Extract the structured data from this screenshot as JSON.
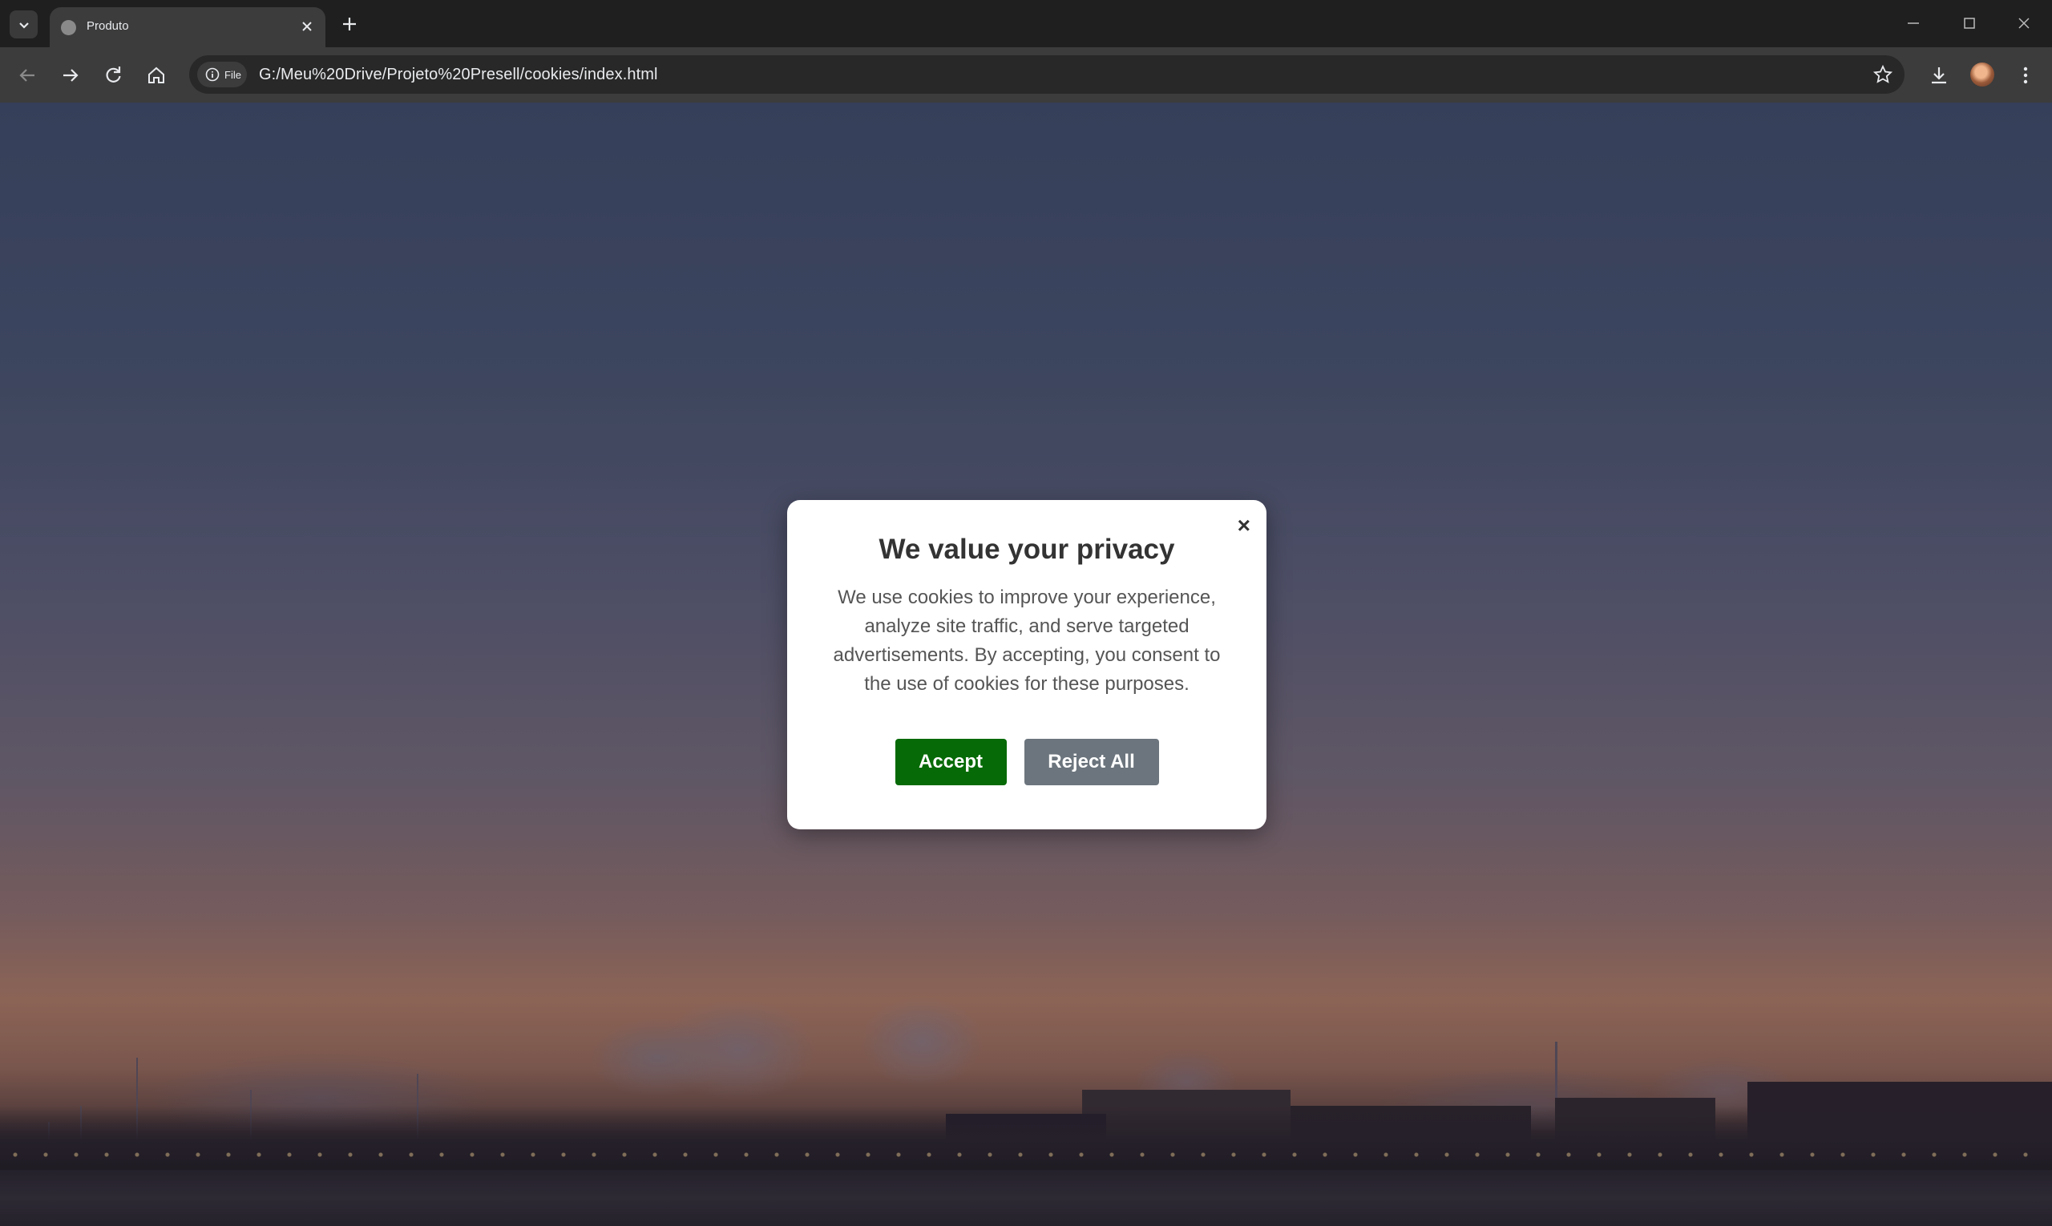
{
  "browser": {
    "tab": {
      "title": "Produto"
    },
    "address_bar": {
      "scheme_chip": "File",
      "url": "G:/Meu%20Drive/Projeto%20Presell/cookies/index.html"
    }
  },
  "cookie_modal": {
    "close_symbol": "×",
    "title": "We value your privacy",
    "body": "We use cookies to improve your experience, analyze site traffic, and serve targeted advertisements. By accepting, you consent to the use of cookies for these purposes.",
    "accept_label": "Accept",
    "reject_label": "Reject All"
  },
  "colors": {
    "accept_button": "#066a06",
    "reject_button": "#6c757d",
    "browser_frame": "#1f1f1f",
    "toolbar": "#3c3c3c"
  },
  "icons": [
    "tab-search-icon",
    "globe-icon",
    "close-icon",
    "plus-icon",
    "minimize-icon",
    "maximize-icon",
    "window-close-icon",
    "back-arrow-icon",
    "forward-arrow-icon",
    "reload-icon",
    "home-icon",
    "info-icon",
    "star-icon",
    "download-icon",
    "kebab-menu-icon"
  ]
}
